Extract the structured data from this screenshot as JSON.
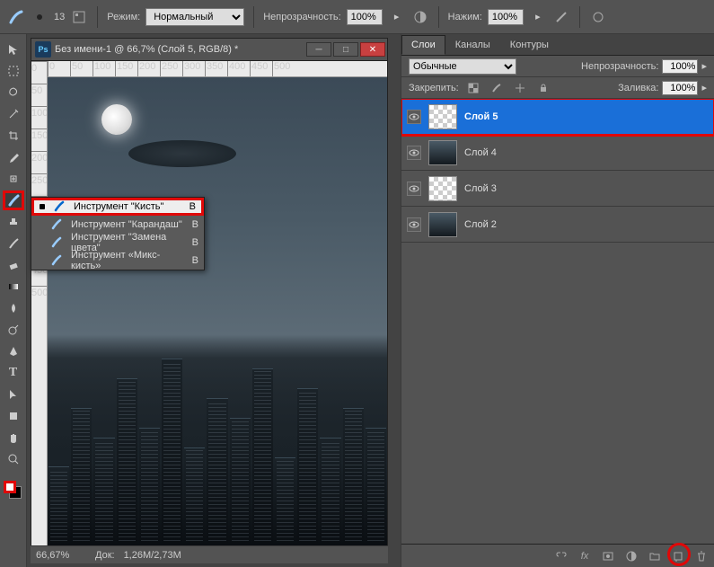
{
  "topbar": {
    "brush_size": "13",
    "mode_label": "Режим:",
    "mode_value": "Нормальный",
    "opacity_label": "Непрозрачность:",
    "opacity_value": "100%",
    "flow_label": "Нажим:",
    "flow_value": "100%"
  },
  "document": {
    "title": "Без имени-1 @ 66,7% (Слой 5, RGB/8) *",
    "ruler_marks": [
      "0",
      "50",
      "100",
      "150",
      "200",
      "250",
      "300",
      "350",
      "400",
      "450",
      "500"
    ]
  },
  "brush_flyout": {
    "items": [
      {
        "label": "Инструмент \"Кисть\"",
        "key": "B",
        "selected": true
      },
      {
        "label": "Инструмент \"Карандаш\"",
        "key": "B",
        "selected": false
      },
      {
        "label": "Инструмент \"Замена цвета\"",
        "key": "B",
        "selected": false
      },
      {
        "label": "Инструмент «Микс-кисть»",
        "key": "B",
        "selected": false
      }
    ]
  },
  "statusbar": {
    "zoom": "66,67%",
    "doc_label": "Док:",
    "doc_value": "1,26M/2,73M"
  },
  "layers_panel": {
    "tabs": [
      "Слои",
      "Каналы",
      "Контуры"
    ],
    "active_tab": 0,
    "blend_mode": "Обычные",
    "opacity_label": "Непрозрачность:",
    "opacity_value": "100%",
    "lock_label": "Закрепить:",
    "fill_label": "Заливка:",
    "fill_value": "100%",
    "layers": [
      {
        "name": "Слой 5",
        "selected": true,
        "thumb": "chk",
        "highlight": true
      },
      {
        "name": "Слой 4",
        "selected": false,
        "thumb": "dark"
      },
      {
        "name": "Слой 3",
        "selected": false,
        "thumb": "chk"
      },
      {
        "name": "Слой 2",
        "selected": false,
        "thumb": "dark"
      }
    ]
  },
  "colors": {
    "fg": "#ffffff",
    "bg": "#000000"
  }
}
